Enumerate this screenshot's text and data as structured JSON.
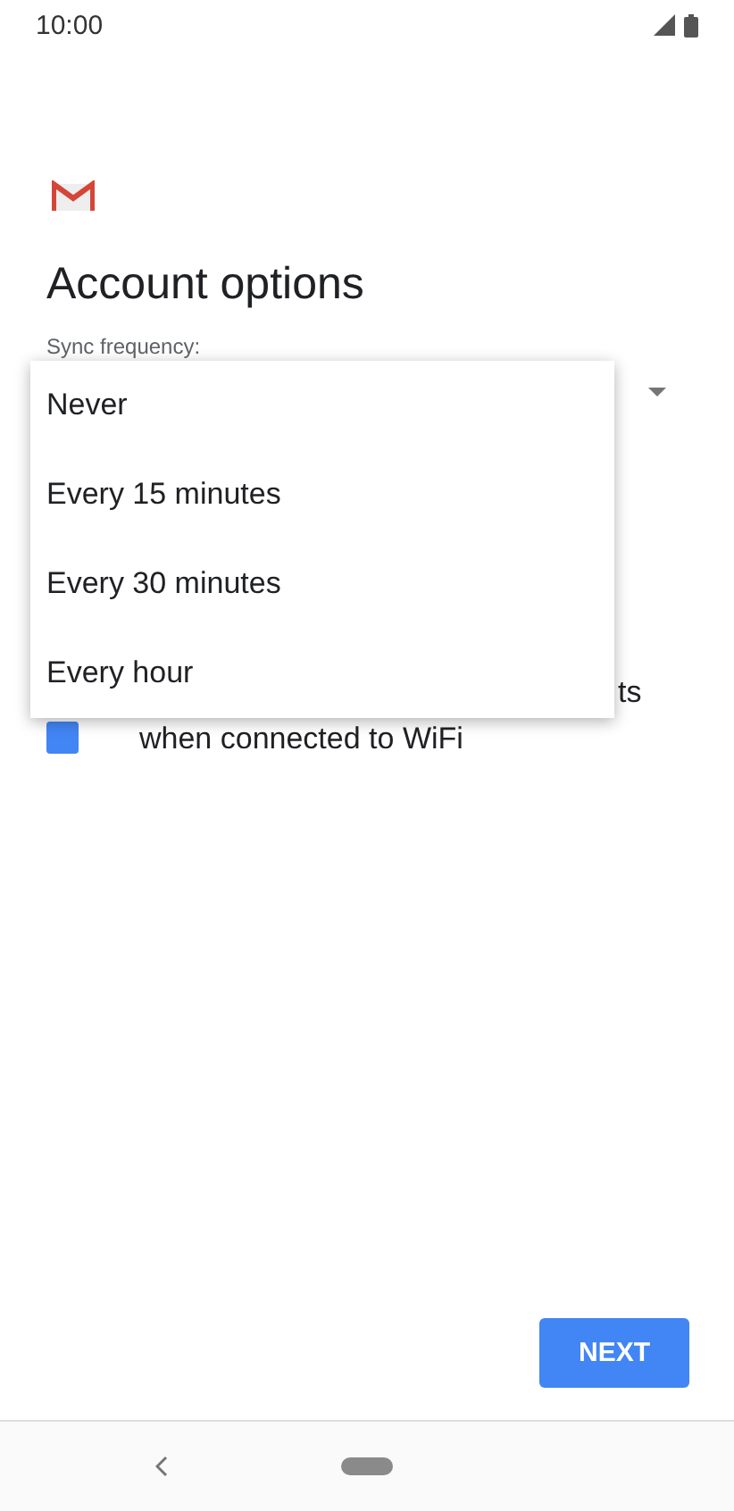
{
  "status_bar": {
    "time": "10:00"
  },
  "title": "Account options",
  "sync_frequency": {
    "label": "Sync frequency:",
    "expanded": true,
    "options": [
      {
        "label": "Never",
        "selected": false
      },
      {
        "label": "Every 15 minutes",
        "selected": false
      },
      {
        "label": "Every 30 minutes",
        "selected": false
      },
      {
        "label": "Every hour",
        "selected": false
      }
    ]
  },
  "checkbox": {
    "checked": true,
    "label_line_1_visible": "ts",
    "label_line_2": "when connected to WiFi"
  },
  "buttons": {
    "next": "NEXT"
  }
}
